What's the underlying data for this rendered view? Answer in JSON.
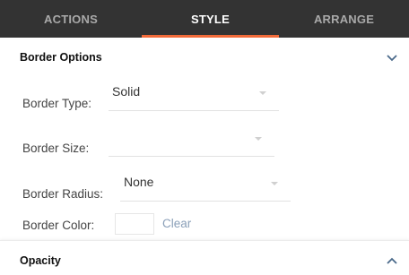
{
  "tabs": [
    {
      "label": "ACTIONS",
      "active": false
    },
    {
      "label": "STYLE",
      "active": true
    },
    {
      "label": "ARRANGE",
      "active": false
    }
  ],
  "colors": {
    "topbar_bg": "#333333",
    "active_tab_underline": "#f26b3a",
    "clear_link": "#8a9fb8"
  },
  "border_options": {
    "title": "Border Options",
    "state_icon": "chevron-down-icon",
    "border_type": {
      "label": "Border Type:",
      "value": "Solid"
    },
    "border_size": {
      "label": "Border Size:",
      "value": ""
    },
    "border_radius": {
      "label": "Border Radius:",
      "value": "None"
    },
    "border_color": {
      "label": "Border Color:",
      "clear_label": "Clear",
      "swatch_color": "#ffffff"
    }
  },
  "opacity": {
    "title": "Opacity",
    "state_icon": "chevron-up-icon"
  }
}
